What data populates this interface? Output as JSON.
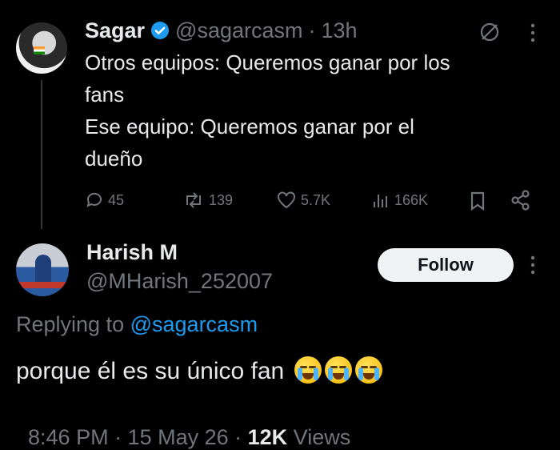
{
  "colors": {
    "background": "#000000",
    "text": "#e7e9ea",
    "muted": "#71767b",
    "link": "#1d9bf0",
    "verified": "#1d9bf0"
  },
  "parent_tweet": {
    "display_name": "Sagar",
    "handle": "@sagarcasm",
    "separator": "·",
    "time": "13h",
    "lines": [
      "Otros equipos: Queremos ganar por los",
      "fans",
      "Ese equipo: Queremos ganar por el",
      "dueño"
    ],
    "actions": {
      "replies": "45",
      "reposts": "139",
      "likes": "5.7K",
      "views": "166K"
    },
    "icons": [
      "verified-badge-icon",
      "grok-icon",
      "more-icon",
      "reply-icon",
      "repost-icon",
      "like-icon",
      "views-icon",
      "bookmark-icon",
      "share-icon"
    ]
  },
  "reply_tweet": {
    "display_name": "Harish M",
    "handle": "@MHarish_252007",
    "follow_label": "Follow",
    "replying_prefix": "Replying to",
    "replying_handle": "@sagarcasm",
    "text": "porque él es su único fan",
    "emojis": [
      "loudly-crying-face",
      "loudly-crying-face",
      "loudly-crying-face"
    ],
    "timestamp": "8:46 PM · 15 May 26 · ",
    "views_count": "12K",
    "views_label": " Views"
  }
}
